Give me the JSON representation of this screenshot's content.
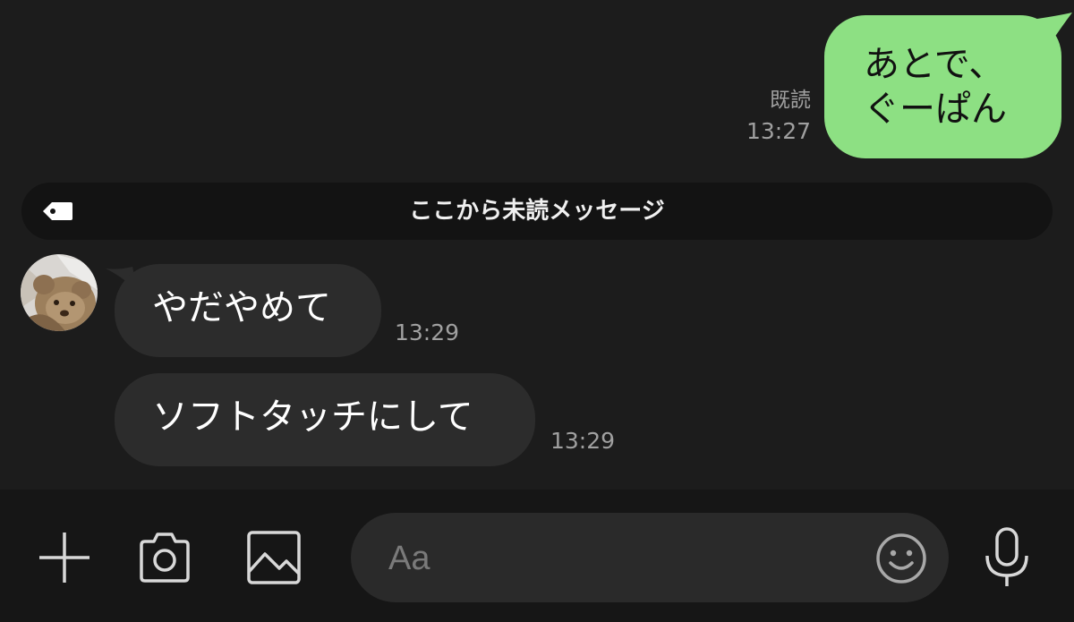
{
  "outgoing": {
    "lines": [
      "あとで、",
      "ぐーぱん"
    ],
    "read_label": "既読",
    "time": "13:27"
  },
  "divider": {
    "label": "ここから未読メッセージ",
    "icon": "tag-icon"
  },
  "incoming": [
    {
      "text": "やだやめて",
      "time": "13:29"
    },
    {
      "text": "ソフトタッチにして",
      "time": "13:29"
    }
  ],
  "input_bar": {
    "placeholder": "Aa",
    "icons": [
      "plus-icon",
      "camera-icon",
      "image-icon",
      "emoji-icon",
      "mic-icon"
    ]
  },
  "colors": {
    "background": "#1c1c1c",
    "outgoing_bubble": "#8de083",
    "incoming_bubble": "#2c2c2c",
    "timestamp": "#a0a0a0",
    "divider_bar": "#131313",
    "input_field": "#2a2a2a"
  }
}
